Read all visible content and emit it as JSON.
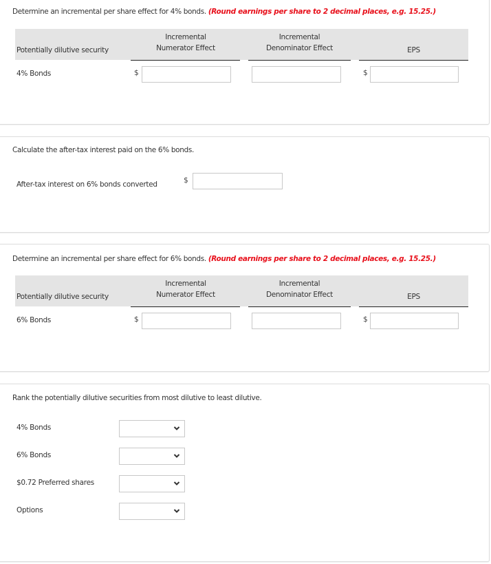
{
  "section_4pct_eps": {
    "instruction": "Determine an incremental per share effect for 4% bonds.",
    "hint": "(Round earnings per share to 2 decimal places, e.g. 15.25.)",
    "table": {
      "headers": {
        "security": "Potentially dilutive security",
        "numerator_line1": "Incremental",
        "numerator_line2": "Numerator Effect",
        "denominator_line1": "Incremental",
        "denominator_line2": "Denominator Effect",
        "eps": "EPS"
      },
      "row": {
        "label": "4% Bonds",
        "numerator_currency": "$",
        "numerator_value": "",
        "denominator_value": "",
        "eps_currency": "$",
        "eps_value": ""
      }
    }
  },
  "section_after_tax": {
    "instruction": "Calculate the after-tax interest paid on the 6% bonds.",
    "field_label": "After-tax interest on 6% bonds converted",
    "currency": "$",
    "value": ""
  },
  "section_6pct_eps": {
    "instruction": "Determine an incremental per share effect for 6% bonds.",
    "hint": "(Round earnings per share to 2 decimal places, e.g. 15.25.)",
    "table": {
      "headers": {
        "security": "Potentially dilutive security",
        "numerator_line1": "Incremental",
        "numerator_line2": "Numerator Effect",
        "denominator_line1": "Incremental",
        "denominator_line2": "Denominator Effect",
        "eps": "EPS"
      },
      "row": {
        "label": "6% Bonds",
        "numerator_currency": "$",
        "numerator_value": "",
        "denominator_value": "",
        "eps_currency": "$",
        "eps_value": ""
      }
    }
  },
  "section_rank": {
    "instruction": "Rank the potentially dilutive securities from most dilutive to least dilutive.",
    "items": [
      {
        "label": "4% Bonds",
        "selected": "",
        "icon": "chevron-down-icon"
      },
      {
        "label": "6% Bonds",
        "selected": "",
        "icon": "chevron-down-icon"
      },
      {
        "label": "$0.72 Preferred shares",
        "selected": "",
        "icon": "chevron-down-icon"
      },
      {
        "label": "Options",
        "selected": "",
        "icon": "chevron-down-icon"
      }
    ]
  },
  "colors": {
    "hint_red": "#e8101b",
    "header_band": "#e4e4e4",
    "text": "#333333"
  }
}
